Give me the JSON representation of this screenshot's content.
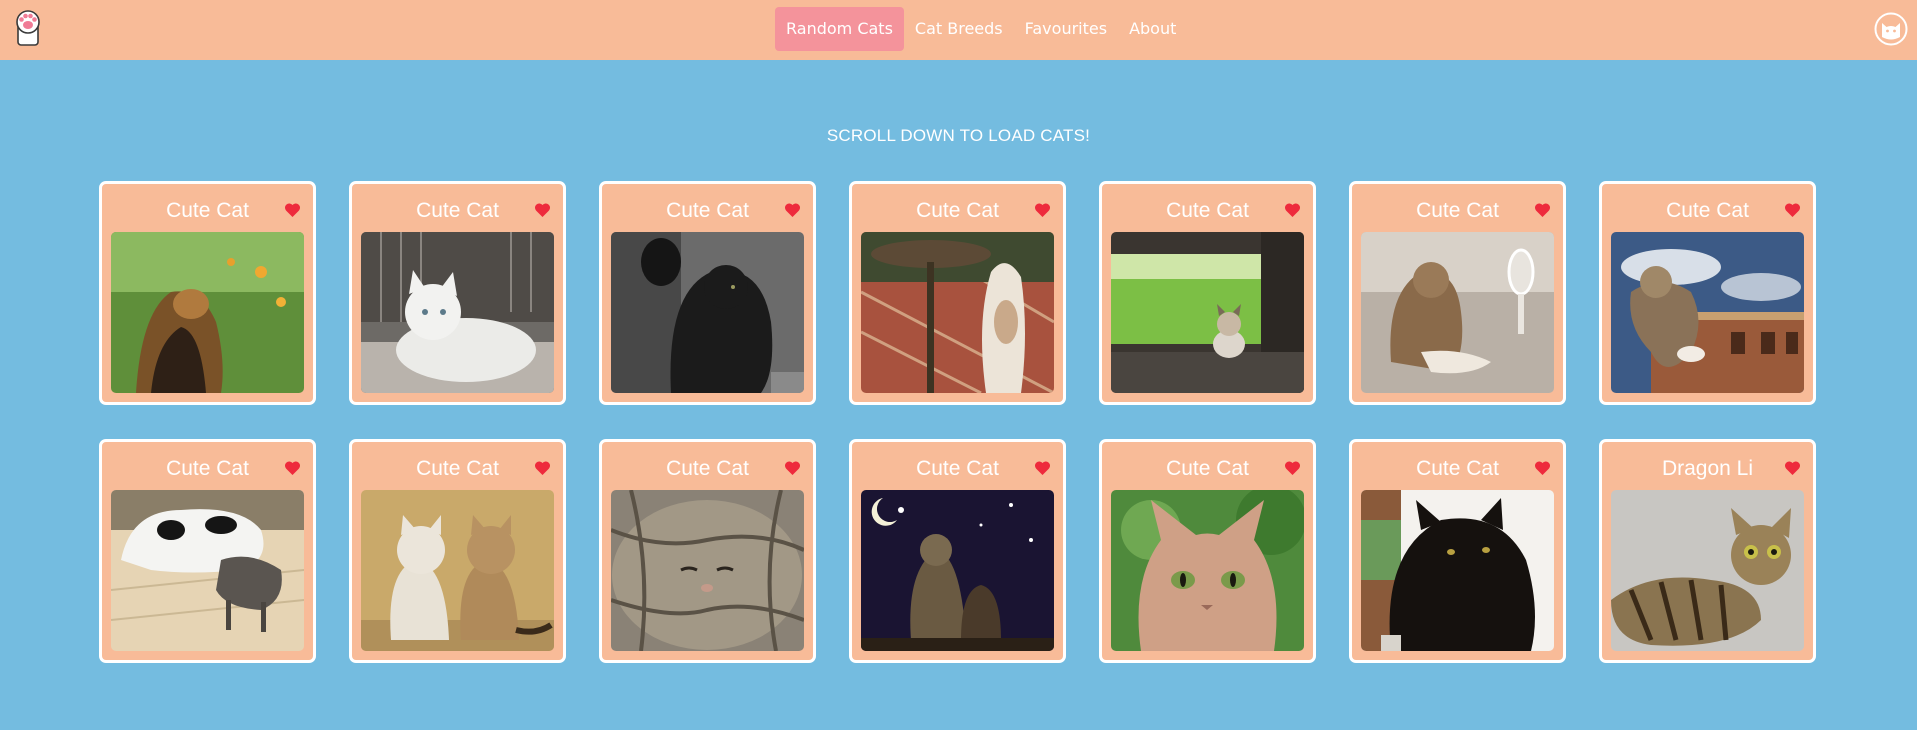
{
  "navbar": {
    "logo_icon": "paw-icon",
    "links": [
      {
        "label": "Random Cats",
        "active": true
      },
      {
        "label": "Cat Breeds",
        "active": false
      },
      {
        "label": "Favourites",
        "active": false
      },
      {
        "label": "About",
        "active": false
      }
    ],
    "profile_icon": "cat-face-icon"
  },
  "main": {
    "hint": "SCROLL DOWN TO LOAD CATS!",
    "cards": [
      {
        "title": "Cute Cat",
        "photo": "calico cat among flowers"
      },
      {
        "title": "Cute Cat",
        "photo": "white kitten by a cage"
      },
      {
        "title": "Cute Cat",
        "photo": "black cat raising paw"
      },
      {
        "title": "Cute Cat",
        "photo": "cat reaching a birdbath"
      },
      {
        "title": "Cute Cat",
        "photo": "cat in a grass tunnel"
      },
      {
        "title": "Cute Cat",
        "photo": "fluffy cat by a mirror"
      },
      {
        "title": "Cute Cat",
        "photo": "cat walking by a brick building"
      },
      {
        "title": "Cute Cat",
        "photo": "cat with a toy cow"
      },
      {
        "title": "Cute Cat",
        "photo": "two kittens sitting"
      },
      {
        "title": "Cute Cat",
        "photo": "sleeping tabby cat"
      },
      {
        "title": "Cute Cat",
        "photo": "cats under the moon"
      },
      {
        "title": "Cute Cat",
        "photo": "sphynx cat face"
      },
      {
        "title": "Cute Cat",
        "photo": "long-haired black cat"
      },
      {
        "title": "Dragon Li",
        "photo": "tabby cat lying down"
      }
    ]
  },
  "colors": {
    "navbar": "#f8bb98",
    "background": "#74bce0",
    "active_link": "#f4939b",
    "heart": "#ee2a3c"
  }
}
